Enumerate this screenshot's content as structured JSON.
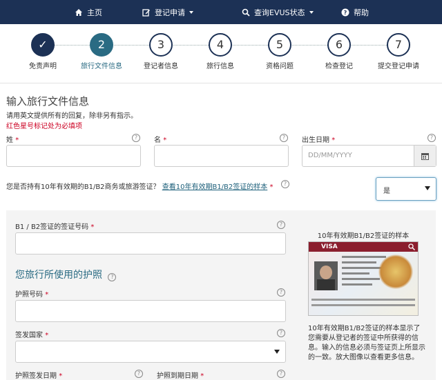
{
  "nav": {
    "home": "主页",
    "register": "登记申请",
    "check_status": "查询EVUS状态",
    "help": "帮助"
  },
  "steps": [
    {
      "num": "✓",
      "label": "免责声明"
    },
    {
      "num": "2",
      "label": "旅行文件信息"
    },
    {
      "num": "3",
      "label": "登记者信息"
    },
    {
      "num": "4",
      "label": "旅行信息"
    },
    {
      "num": "5",
      "label": "资格问题"
    },
    {
      "num": "6",
      "label": "检查登记"
    },
    {
      "num": "7",
      "label": "提交登记申请"
    }
  ],
  "form": {
    "title": "输入旅行文件信息",
    "note_english": "请用英文提供所有的回复，除非另有指示。",
    "note_required": "红色星号标记处为必填项",
    "surname_label": "姓",
    "given_name_label": "名",
    "dob_label": "出生日期",
    "dob_placeholder": "DD/MM/YYYY",
    "required_mark": "*",
    "visa_question": "您是否持有10年有效期的B1/B2商务或旅游签证？",
    "visa_question_link": "查看10年有效期B1/B2签证的样本",
    "visa_answer": "是",
    "visa_number_label": "B1 / B2签证的签证号码",
    "passport_section": "您旅行所使用的护照",
    "passport_number_label": "护照号码",
    "issuing_country_label": "签发国家",
    "passport_issue_date_label": "护照签发日期",
    "passport_expiry_date_label": "护照到期日期"
  },
  "sample": {
    "title": "10年有效期B1/B2签证的样本",
    "visa_word": "VISA",
    "description": "10年有效期B1/B2签证的样本显示了您需要从登记者的签证中所获得的信息。输入的信息必须与签证页上所显示的一致。放大图像以查看更多信息。"
  },
  "colors": {
    "nav_bg": "#1c3155",
    "current_step": "#2a6b83",
    "required": "#cc0022",
    "link": "#1c5f7a"
  }
}
